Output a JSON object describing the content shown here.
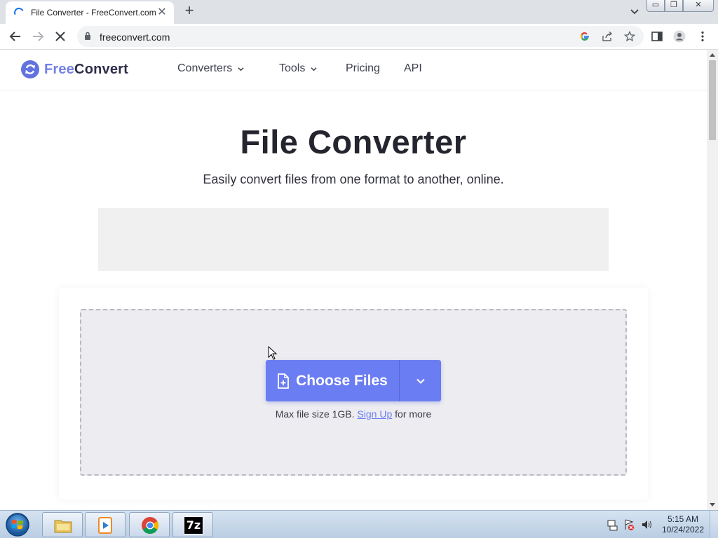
{
  "browser": {
    "tab_title": "File Converter - FreeConvert.com",
    "tab_close": "✕",
    "new_tab": "+",
    "url": "freeconvert.com",
    "window_buttons": [
      "▭",
      "❐",
      "✕"
    ]
  },
  "site": {
    "logo_free": "Free",
    "logo_convert": "Convert",
    "nav": [
      {
        "label": "Converters"
      },
      {
        "label": "Tools"
      },
      {
        "label": "Pricing"
      },
      {
        "label": "API"
      }
    ]
  },
  "hero": {
    "title": "File Converter",
    "subtitle": "Easily convert files from one format to another, online."
  },
  "upload": {
    "button_label": "Choose Files",
    "note_prefix": "Max file size 1GB.",
    "note_link": "Sign Up",
    "note_suffix": "for more"
  },
  "taskbar": {
    "time": "5:15 AM",
    "date": "10/24/2022",
    "apps": [
      "explorer",
      "media-player",
      "chrome",
      "7-zip"
    ],
    "sevenzip_label": "7z"
  },
  "colors": {
    "brand": "#6b7df2",
    "logo_mark": "#6272de",
    "dropzone_bg": "#ececf1"
  }
}
